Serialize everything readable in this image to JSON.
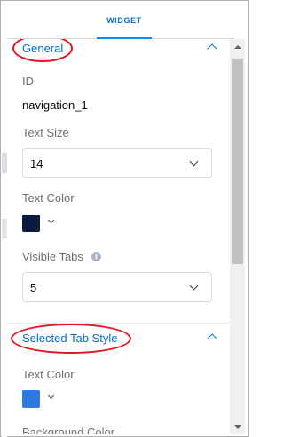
{
  "tabs": {
    "widget_label": "WIDGET"
  },
  "general": {
    "title": "General",
    "id_label": "ID",
    "id_value": "navigation_1",
    "text_size_label": "Text Size",
    "text_size_value": "14",
    "text_color_label": "Text Color",
    "text_color_hex": "#0a1a3f",
    "visible_tabs_label": "Visible Tabs",
    "visible_tabs_value": "5"
  },
  "selected_tab_style": {
    "title": "Selected Tab Style",
    "text_color_label": "Text Color",
    "text_color_hex": "#2b7be0",
    "background_color_label": "Background Color"
  },
  "icons": {
    "collapse": "chevron-up-icon",
    "dropdown": "chevron-down-icon",
    "info": "info-icon"
  },
  "colors": {
    "accent": "#0070d2",
    "annotation": "#e3131f"
  }
}
